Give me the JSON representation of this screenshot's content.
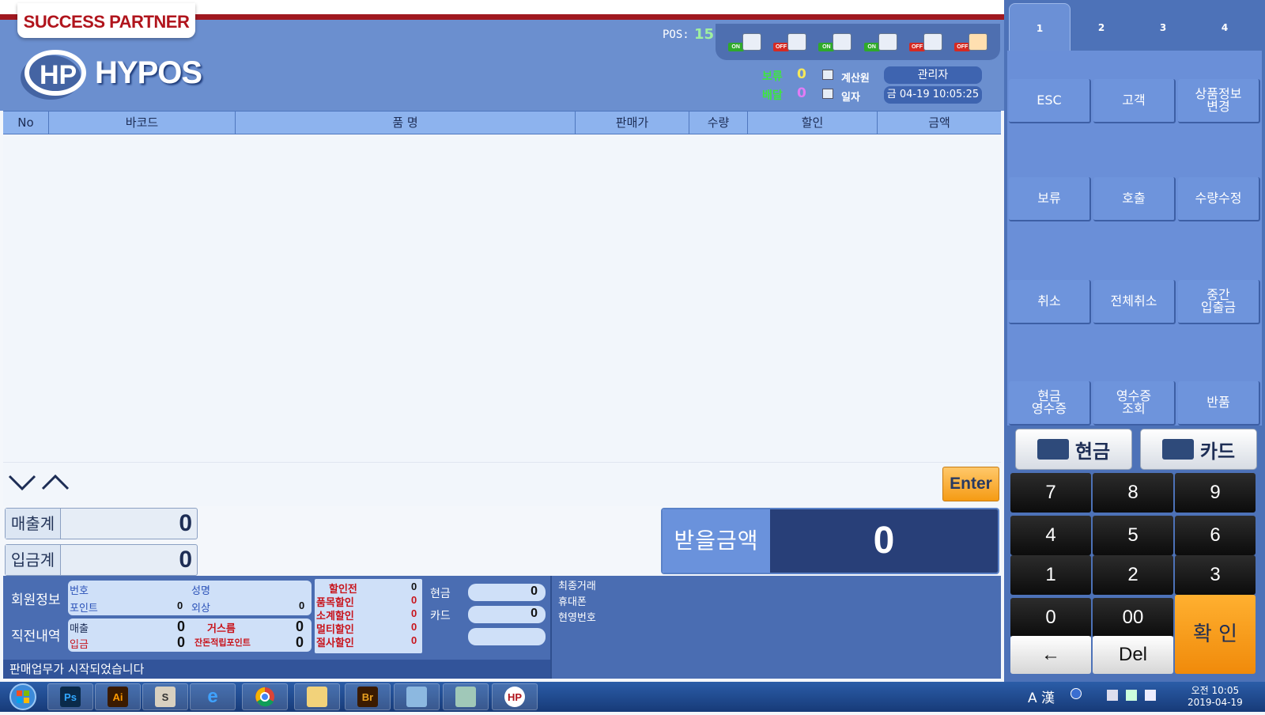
{
  "header": {
    "partner": "SUCCESS PARTNER",
    "logo_text": "HYPOS",
    "pos_label": "POS:",
    "pos_number": "15",
    "devices": [
      {
        "name": "printer",
        "state": "ON"
      },
      {
        "name": "stamp",
        "state": "OFF"
      },
      {
        "name": "network",
        "state": "ON"
      },
      {
        "name": "card-reader",
        "state": "ON"
      },
      {
        "name": "delivery",
        "state": "OFF"
      },
      {
        "name": "ok-status",
        "state": "OFF"
      }
    ],
    "hold_label": "보류",
    "hold_value": "0",
    "delivery_label": "배달",
    "delivery_value": "0",
    "cashier_label": "계산원",
    "cashier_value": "관리자",
    "date_label": "일자",
    "date_value": "금 04-19 10:05:25"
  },
  "table": {
    "columns": [
      "No",
      "바코드",
      "품 명",
      "판매가",
      "수량",
      "할인",
      "금액"
    ]
  },
  "enter_label": "Enter",
  "totals": {
    "sales_label": "매출계",
    "sales_value": "0",
    "deposit_label": "입금계",
    "deposit_value": "0",
    "receive_label": "받을금액",
    "receive_value": "0"
  },
  "member": {
    "section_label": "회원정보",
    "number_label": "번호",
    "name_label": "성명",
    "point_label": "포인트",
    "point_value": "0",
    "credit_label": "외상",
    "credit_value": "0"
  },
  "recent": {
    "section_label": "직전내역",
    "sales_label": "매출",
    "sales_value": "0",
    "change_label": "거스름",
    "change_value": "0",
    "deposit_label": "입금",
    "deposit_value": "0",
    "remain_point_label": "잔돈적립포인트",
    "remain_point_value": "0"
  },
  "discounts": [
    {
      "label": "할인전",
      "value": "0"
    },
    {
      "label": "품목할인",
      "value": "0"
    },
    {
      "label": "소계할인",
      "value": "0"
    },
    {
      "label": "멀티할인",
      "value": "0"
    },
    {
      "label": "절사할인",
      "value": "0"
    }
  ],
  "payments_mini": {
    "cash_label": "현금",
    "cash_value": "0",
    "card_label": "카드",
    "card_value": "0"
  },
  "status_message": "판매업무가 시작되었습니다",
  "right_info": [
    "최종거래",
    "휴대폰",
    "현영번호"
  ],
  "tabs": [
    "1",
    "2",
    "3",
    "4"
  ],
  "function_keys": [
    "ESC",
    "고객",
    "상품정보\n변경",
    "보류",
    "호출",
    "수량수정",
    "취소",
    "전체취소",
    "중간\n입출금",
    "현금\n영수증",
    "영수증\n조회",
    "반품"
  ],
  "pay_buttons": {
    "cash": "현금",
    "card": "카드"
  },
  "keypad": [
    "7",
    "8",
    "9",
    "4",
    "5",
    "6",
    "1",
    "2",
    "3",
    "0",
    "00"
  ],
  "keypad_back": "←",
  "keypad_del": "Del",
  "confirm_label": "확 인",
  "taskbar": {
    "apps": [
      "Ps",
      "Ai",
      "S",
      "e",
      "chrome",
      "folder",
      "Br",
      "photo",
      "edit",
      "hypos"
    ],
    "ime": "A 漢",
    "time": "오전 10:05",
    "date": "2019-04-19"
  }
}
